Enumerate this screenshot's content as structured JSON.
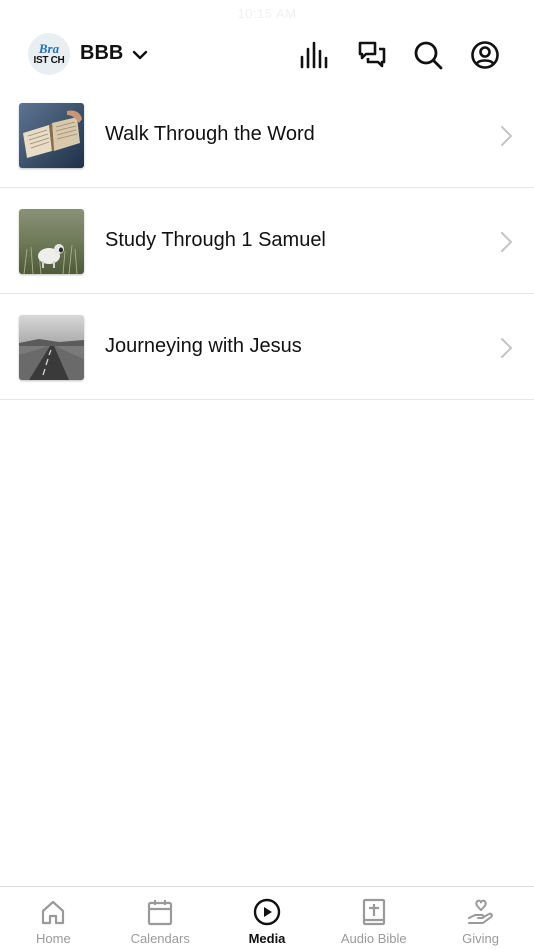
{
  "status_bar": {
    "time": "10:15 AM"
  },
  "header": {
    "org_logo_text_top": "Bra",
    "org_logo_text_bottom": "IST CH",
    "org_name": "BBB",
    "icons": [
      "bars-chart-icon",
      "chat-bubbles-icon",
      "search-icon",
      "account-icon"
    ]
  },
  "media_list": [
    {
      "title": "Walk Through the Word",
      "thumbnail": "open-bible-photo"
    },
    {
      "title": "Study Through 1 Samuel",
      "thumbnail": "lamb-in-field-photo"
    },
    {
      "title": "Journeying with Jesus",
      "thumbnail": "road-landscape-photo"
    }
  ],
  "tab_bar": {
    "tabs": [
      {
        "label": "Home",
        "icon": "home-icon",
        "active": false
      },
      {
        "label": "Calendars",
        "icon": "calendar-icon",
        "active": false
      },
      {
        "label": "Media",
        "icon": "play-circle-icon",
        "active": true
      },
      {
        "label": "Audio Bible",
        "icon": "bible-icon",
        "active": false
      },
      {
        "label": "Giving",
        "icon": "hand-heart-icon",
        "active": false
      }
    ]
  },
  "colors": {
    "text": "#111111",
    "inactive_tab": "#9a9a9a",
    "divider": "#e6e6e6",
    "chevron": "#c4c4c4",
    "logo_blue": "#2a6fb3"
  }
}
